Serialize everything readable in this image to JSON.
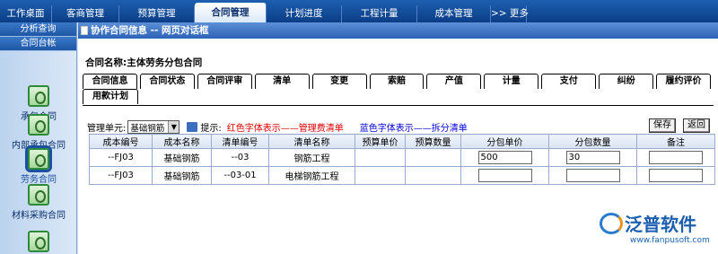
{
  "topnav": {
    "tabs": [
      {
        "label": "工作桌面"
      },
      {
        "label": "客商管理"
      },
      {
        "label": "预算管理"
      },
      {
        "label": "合同管理"
      },
      {
        "label": "计划进度"
      },
      {
        "label": "工程计量"
      },
      {
        "label": "成本管理"
      },
      {
        "label": ">> 更多"
      }
    ],
    "active_index": 3
  },
  "sidebar": {
    "section1": "分析查询",
    "section2": "合同台帐",
    "items": [
      {
        "label": "承包合同",
        "icon": "contract-icon"
      },
      {
        "label": "内部承包合同",
        "icon": "contract-icon"
      },
      {
        "label": "劳务合同",
        "icon": "contract-icon",
        "selected": true
      },
      {
        "label": "材料采购合同",
        "icon": "contract-icon"
      },
      {
        "label": "",
        "icon": "contract-icon"
      }
    ]
  },
  "dialog": {
    "title": "协作合同信息 -- 网页对话框",
    "contract_name": "合同名称:主体劳务分包合同"
  },
  "tabs": {
    "row1": [
      "合同信息",
      "合同状态",
      "合同评审",
      "清单",
      "变更",
      "索赔",
      "产值",
      "计量",
      "支付",
      "纠纷",
      "履约评价"
    ],
    "row2": [
      "用款计划"
    ],
    "active": "清单"
  },
  "unit": {
    "label": "管理单元:",
    "selected": "基础钢筋",
    "tip_label": "提示:",
    "tip_red": "红色字体表示——管理费清单",
    "tip_blue": "蓝色字体表示——拆分清单"
  },
  "buttons": {
    "save": "保存",
    "back": "返回"
  },
  "table": {
    "headers": [
      "成本编号",
      "成本名称",
      "清单编号",
      "清单名称",
      "预算单价",
      "预算数量",
      "分包单价",
      "分包数量",
      "备注"
    ],
    "rows": [
      {
        "cost_no": "--FJ03",
        "cost_name": "基础钢筋",
        "list_no": "--03",
        "list_name": "钢筋工程",
        "budget_price": "",
        "budget_qty": "",
        "sub_price": "500",
        "sub_qty": "30",
        "note": ""
      },
      {
        "cost_no": "--FJ03",
        "cost_name": "基础钢筋",
        "list_no": "--03-01",
        "list_name": "电梯钢筋工程",
        "budget_price": "",
        "budget_qty": "",
        "sub_price": "",
        "sub_qty": "",
        "note": ""
      }
    ]
  },
  "logo": {
    "name": "泛普软件",
    "url": "www.fanpusoft.com"
  }
}
